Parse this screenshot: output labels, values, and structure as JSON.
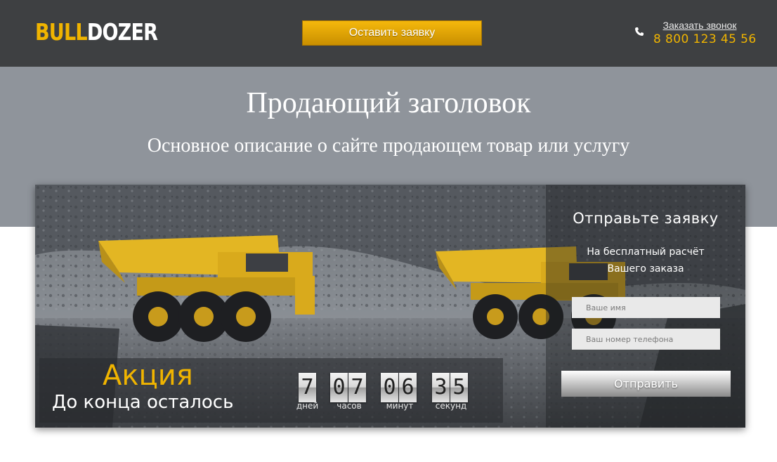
{
  "header": {
    "logo_part1": "BULL",
    "logo_part2": "DOZER",
    "cta_label": "Оставить заявку",
    "callback_label": "Заказать звонок",
    "phone": "8 800 123 45 56",
    "phone_icon": "phone-icon"
  },
  "hero": {
    "title": "Продающий заголовок",
    "subtitle": "Основное описание о сайте продающем товар или услугу"
  },
  "form": {
    "title": "Отправьте заявку",
    "subtitle": "На бесплатный расчёт Вашего заказа",
    "name_placeholder": "Ваше имя",
    "phone_placeholder": "Ваш номер телефона",
    "submit_label": "Отправить"
  },
  "promo": {
    "title": "Акция",
    "subtitle": "До конца осталось",
    "days": "7",
    "hours": "07",
    "minutes": "06",
    "seconds": "35",
    "days_label": "дней",
    "hours_label": "часов",
    "minutes_label": "минут",
    "seconds_label": "секунд"
  },
  "colors": {
    "accent": "#f0b400",
    "header_bg": "#3e4042",
    "hero_bg": "#8f949b"
  }
}
